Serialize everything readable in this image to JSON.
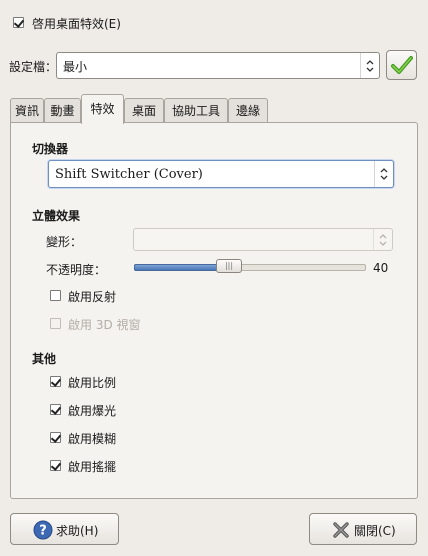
{
  "top": {
    "enable_effects_label": "啓用桌面特效(E)",
    "enable_effects_checked": true
  },
  "profile": {
    "label": "設定檔：",
    "value": "最小",
    "apply_icon": "checkmark-icon"
  },
  "tabs": [
    {
      "label": "資訊"
    },
    {
      "label": "動畫"
    },
    {
      "label": "特效",
      "active": true
    },
    {
      "label": "桌面"
    },
    {
      "label": "協助工具"
    },
    {
      "label": "邊緣"
    }
  ],
  "switcher": {
    "heading": "切換器",
    "value": "Shift Switcher (Cover)"
  },
  "effects3d": {
    "heading": "立體效果",
    "deform_label": "變形：",
    "deform_value": "",
    "opacity_label": "不透明度：",
    "opacity_value": "40",
    "opacity_fraction": 0.4,
    "reflection_label": "啟用反射",
    "reflection_checked": false,
    "windows3d_label": "啟用 3D 視窗",
    "windows3d_checked": false,
    "windows3d_disabled": true
  },
  "other": {
    "heading": "其他",
    "items": [
      {
        "label": "啟用比例",
        "checked": true
      },
      {
        "label": "啟用爆光",
        "checked": true
      },
      {
        "label": "啟用模糊",
        "checked": true
      },
      {
        "label": "啟用搖擺",
        "checked": true
      }
    ]
  },
  "footer": {
    "help_label": "求助(H)",
    "help_icon": "help-icon",
    "close_label": "關閉(C)",
    "close_icon": "close-icon"
  }
}
